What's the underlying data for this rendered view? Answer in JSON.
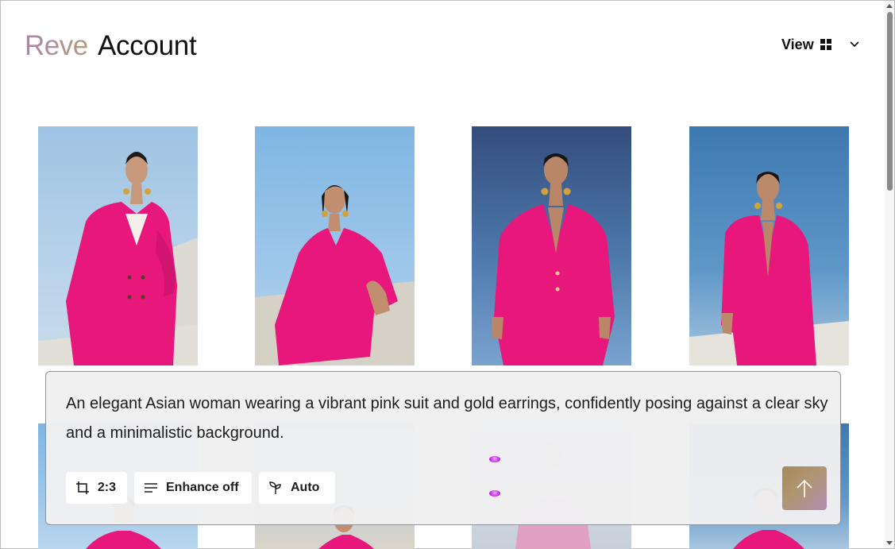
{
  "header": {
    "brand": "Reve",
    "title": "Account",
    "view_label": "View",
    "view_icon": "grid-icon",
    "chevron_icon": "chevron-down-icon"
  },
  "gallery": {
    "images": [
      {
        "subject": "pink-suit-portrait-1",
        "row": 1
      },
      {
        "subject": "pink-suit-portrait-2",
        "row": 1
      },
      {
        "subject": "pink-suit-portrait-3",
        "row": 1
      },
      {
        "subject": "pink-suit-portrait-4",
        "row": 1
      },
      {
        "subject": "pink-suit-portrait-5",
        "row": 2
      },
      {
        "subject": "pink-suit-portrait-6",
        "row": 2
      },
      {
        "subject": "pink-suit-portrait-7",
        "row": 2
      },
      {
        "subject": "pink-suit-portrait-8",
        "row": 2
      }
    ]
  },
  "composer": {
    "prompt": "An elegant Asian woman wearing a vibrant pink suit and gold earrings, confidently posing against a clear sky and a minimalistic background.",
    "aspect_ratio": "2:3",
    "enhance": "Enhance off",
    "mode": "Auto",
    "icons": {
      "ratio": "crop-icon",
      "enhance": "lines-icon",
      "mode": "sprout-icon",
      "submit": "arrow-up-icon"
    }
  },
  "colors": {
    "accent_gradient_start": "#a48a5a",
    "accent_gradient_end": "#b38cb4",
    "loader": "#c021e6",
    "suit_pink": "#e8177c"
  }
}
